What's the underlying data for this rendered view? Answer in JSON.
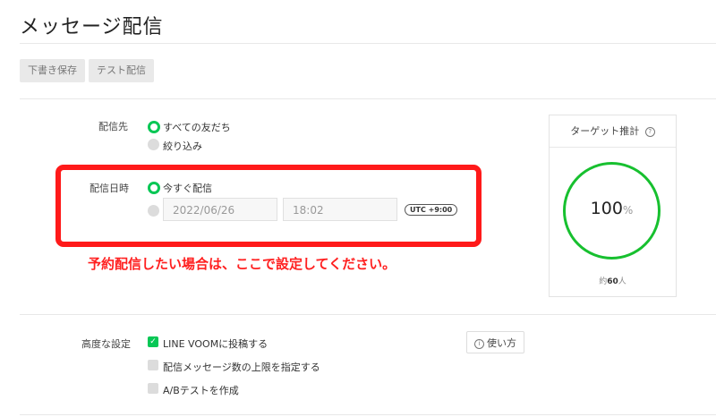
{
  "page": {
    "title": "メッセージ配信"
  },
  "toolbar": {
    "draft_label": "下書き保存",
    "test_label": "テスト配信"
  },
  "recipient": {
    "label": "配信先",
    "options": [
      {
        "label": "すべての友だち",
        "selected": true
      },
      {
        "label": "絞り込み",
        "selected": false
      }
    ]
  },
  "schedule": {
    "label": "配信日時",
    "now_label": "今すぐ配信",
    "now_selected": true,
    "date_value": "2022/06/26",
    "time_value": "18:02",
    "timezone": "UTC +9:00"
  },
  "annotation": {
    "text": "予約配信したい場合は、ここで設定してください。",
    "color": "#ff1a1a"
  },
  "target": {
    "title": "ターゲット推計",
    "info_icon": "info-icon",
    "percent": "100",
    "percent_unit": "%",
    "count_prefix": "約",
    "count": "60",
    "count_unit": "人",
    "gauge_color": "#17c02f"
  },
  "advanced": {
    "label": "高度な設定",
    "options": [
      {
        "label": "LINE VOOMに投稿する",
        "checked": true
      },
      {
        "label": "配信メッセージ数の上限を指定する",
        "checked": false
      },
      {
        "label": "A/Bテストを作成",
        "checked": false
      }
    ],
    "help_label": "使い方"
  },
  "colors": {
    "accent": "#06c755"
  }
}
